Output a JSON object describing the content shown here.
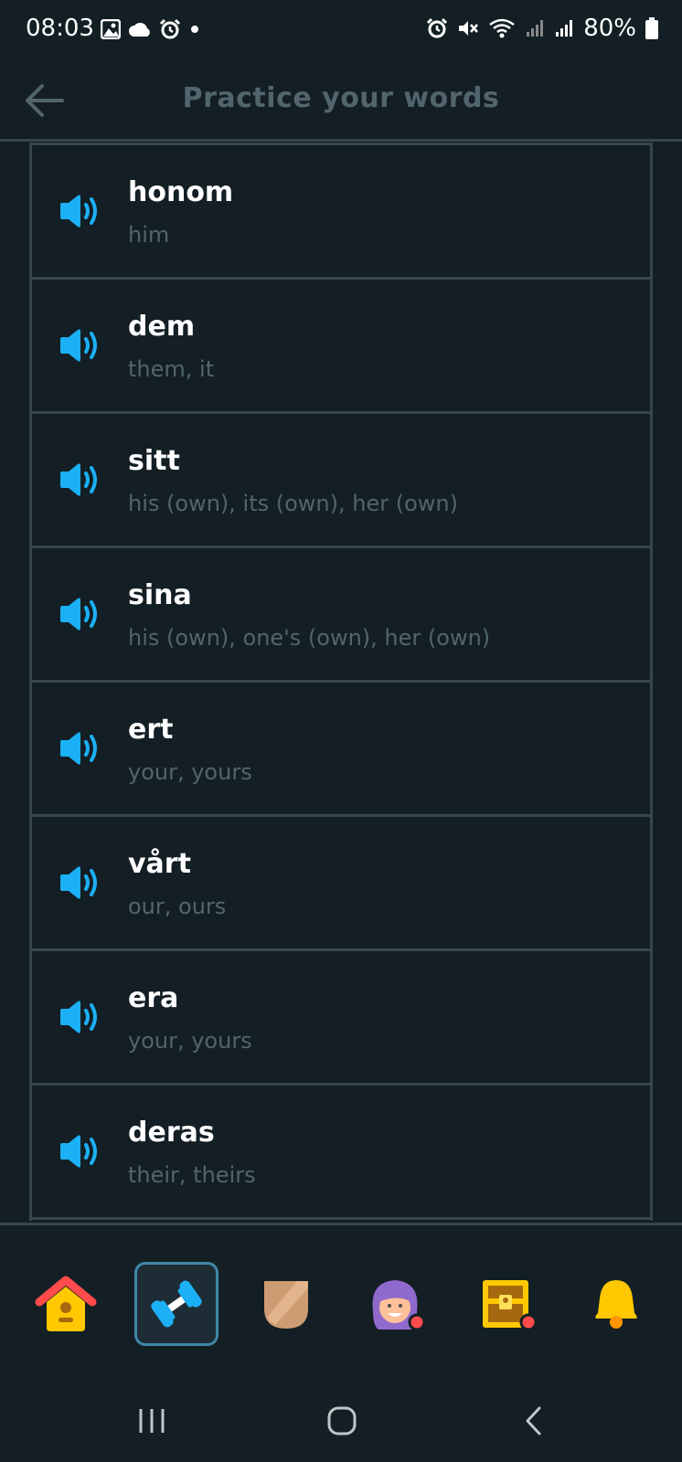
{
  "status_bar": {
    "time": "08:03",
    "battery": "80%",
    "left_icons": [
      "gallery-icon",
      "cloud-icon",
      "alarm-icon",
      "dot-icon"
    ],
    "right_icons": [
      "alarm-icon",
      "mute-icon",
      "wifi-icon",
      "signal-icon",
      "signal-icon",
      "battery-icon"
    ]
  },
  "header": {
    "title": "Practice your words",
    "back_icon": "back-arrow-icon"
  },
  "words": [
    {
      "word": "honom",
      "translation": "him"
    },
    {
      "word": "dem",
      "translation": "them, it"
    },
    {
      "word": "sitt",
      "translation": "his (own), its (own), her (own)"
    },
    {
      "word": "sina",
      "translation": "his (own), one's (own), her (own)"
    },
    {
      "word": "ert",
      "translation": "your, yours"
    },
    {
      "word": "vårt",
      "translation": "our, ours"
    },
    {
      "word": "era",
      "translation": "your, yours"
    },
    {
      "word": "deras",
      "translation": "their, theirs"
    }
  ],
  "tabs": [
    {
      "name": "home",
      "icon": "home-icon",
      "active": false
    },
    {
      "name": "practice",
      "icon": "dumbbell-icon",
      "active": true
    },
    {
      "name": "leagues",
      "icon": "shield-icon",
      "active": false
    },
    {
      "name": "profile",
      "icon": "avatar-icon",
      "active": false
    },
    {
      "name": "shop",
      "icon": "chest-icon",
      "active": false
    },
    {
      "name": "notifications",
      "icon": "bell-icon",
      "active": false
    }
  ],
  "colors": {
    "background": "#131f24",
    "border": "#37464f",
    "muted_text": "#52656d",
    "speaker_blue": "#1cb0f6",
    "active_tab_border": "#3f88a8"
  }
}
